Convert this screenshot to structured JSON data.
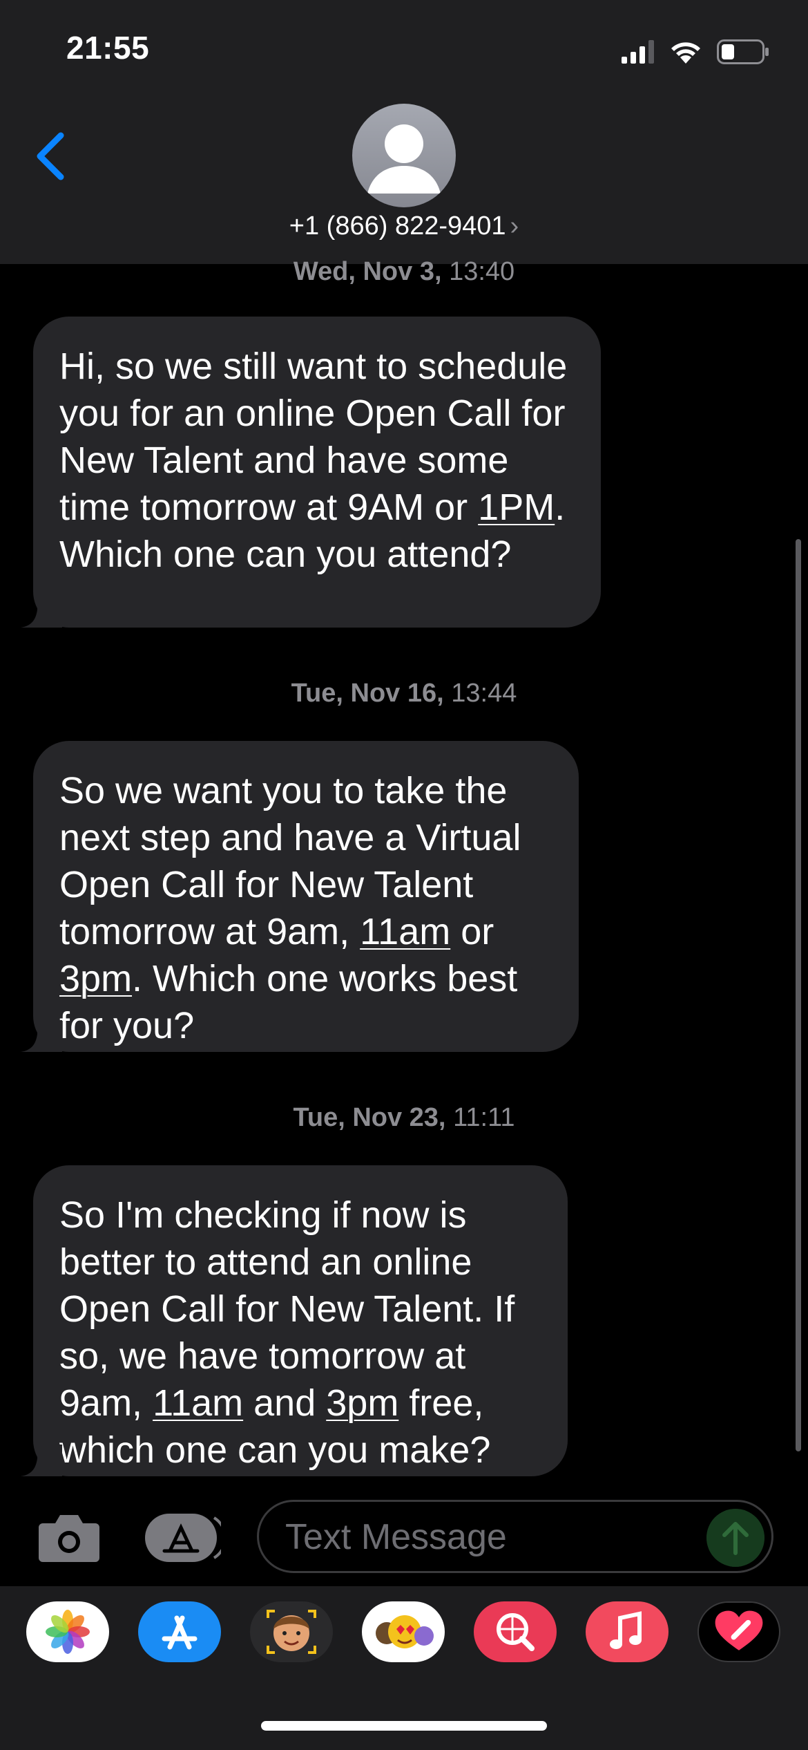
{
  "status_bar": {
    "time": "21:55"
  },
  "header": {
    "contact_number": "+1 (866) 822-9401",
    "chevron": "›"
  },
  "messages": [
    {
      "timestamp_day": "Wed, Nov 3,",
      "timestamp_time": "13:40",
      "parts": [
        "Hi, so we still want to schedule you for an online Open Call for New Talent and have some time tomorrow at 9AM or ",
        "1PM",
        ". Which one can you attend?"
      ]
    },
    {
      "timestamp_day": "Tue, Nov 16,",
      "timestamp_time": "13:44",
      "parts": [
        "So we want you to take the next step and have a Virtual Open Call for New Talent tomorrow at 9am, ",
        "11am",
        " or ",
        "3pm",
        ". Which one works best for you?"
      ]
    },
    {
      "timestamp_day": "Tue, Nov 23,",
      "timestamp_time": "11:11",
      "parts": [
        "So I'm checking if now is better to attend an online Open Call for New Talent. If so, we have tomorrow at 9am, ",
        "11am",
        " and ",
        "3pm",
        " free, which one can you make?"
      ]
    }
  ],
  "composer": {
    "placeholder": "Text Message"
  },
  "app_strip": [
    "photos-icon",
    "app-store-icon",
    "memoji-stickers-icon",
    "animoji-icon",
    "web-images-search-icon",
    "music-icon",
    "digital-touch-icon"
  ],
  "colors": {
    "accent_blue": "#0a84ff",
    "bubble": "#262629",
    "send_green": "#163b1e"
  }
}
